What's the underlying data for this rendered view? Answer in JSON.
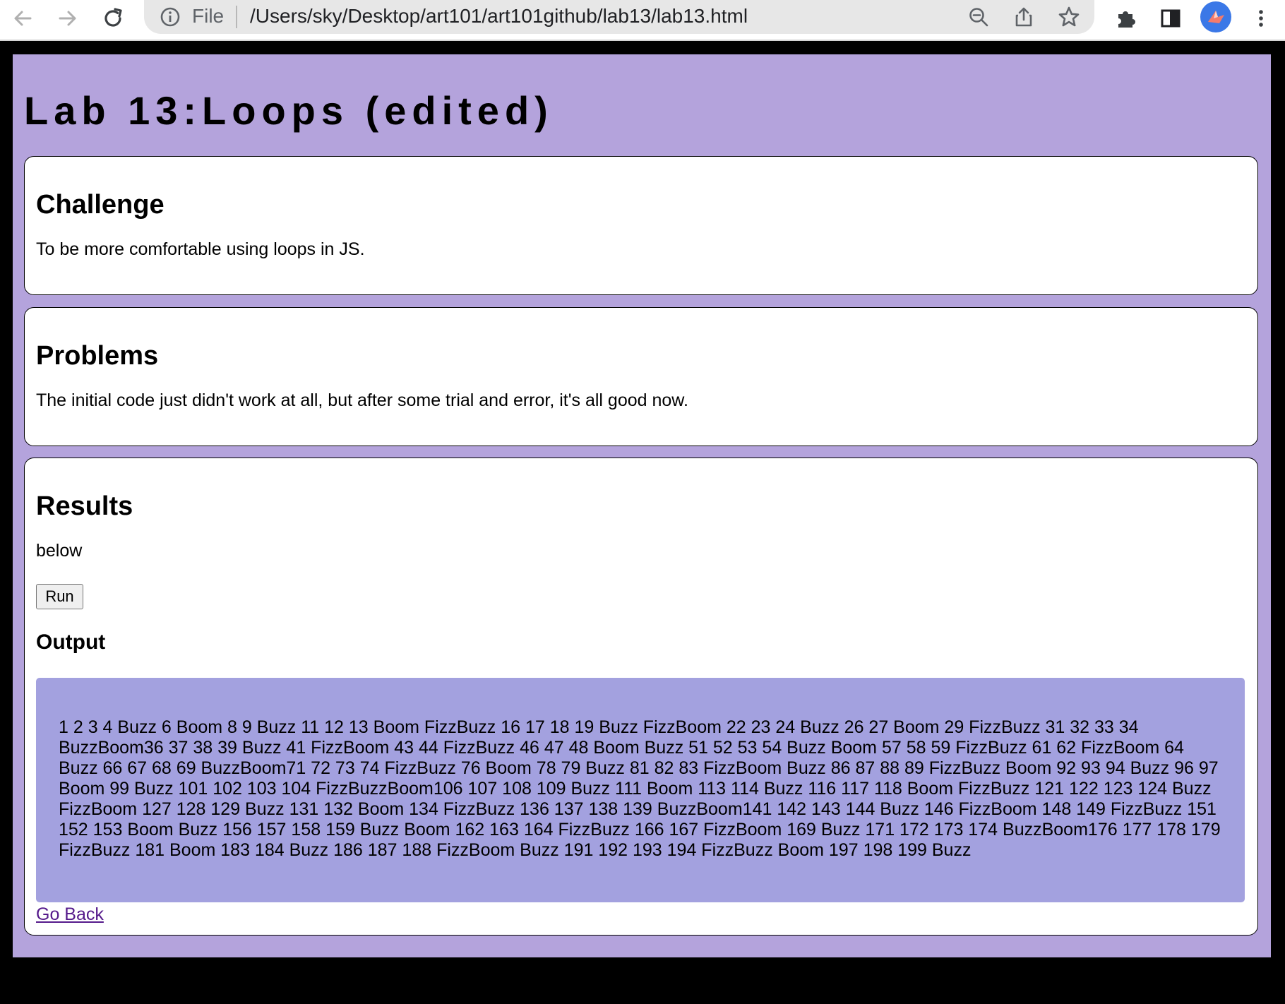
{
  "browser": {
    "file_label": "File",
    "url": "/Users/sky/Desktop/art101/art101github/lab13/lab13.html"
  },
  "page": {
    "title": "Lab 13:Loops (edited)",
    "background": "#b4a3dc"
  },
  "challenge": {
    "heading": "Challenge",
    "text": "To be more comfortable using loops in JS."
  },
  "problems": {
    "heading": "Problems",
    "text": "The initial code just didn't work at all, but after some trial and error, it's all good now."
  },
  "results": {
    "heading": "Results",
    "text": "below",
    "run_label": "Run",
    "output_heading": "Output",
    "output_text": "1 2 3 4 Buzz 6 Boom 8 9 Buzz 11 12 13 Boom FizzBuzz 16 17 18 19 Buzz FizzBoom 22 23 24 Buzz 26 27 Boom 29 FizzBuzz 31 32 33 34 BuzzBoom36 37 38 39 Buzz 41 FizzBoom 43 44 FizzBuzz 46 47 48 Boom Buzz 51 52 53 54 Buzz Boom 57 58 59 FizzBuzz 61 62 FizzBoom 64 Buzz 66 67 68 69 BuzzBoom71 72 73 74 FizzBuzz 76 Boom 78 79 Buzz 81 82 83 FizzBoom Buzz 86 87 88 89 FizzBuzz Boom 92 93 94 Buzz 96 97 Boom 99 Buzz 101 102 103 104 FizzBuzzBoom106 107 108 109 Buzz 111 Boom 113 114 Buzz 116 117 118 Boom FizzBuzz 121 122 123 124 Buzz FizzBoom 127 128 129 Buzz 131 132 Boom 134 FizzBuzz 136 137 138 139 BuzzBoom141 142 143 144 Buzz 146 FizzBoom 148 149 FizzBuzz 151 152 153 Boom Buzz 156 157 158 159 Buzz Boom 162 163 164 FizzBuzz 166 167 FizzBoom 169 Buzz 171 172 173 174 BuzzBoom176 177 178 179 FizzBuzz 181 Boom 183 184 Buzz 186 187 188 FizzBoom Buzz 191 192 193 194 FizzBuzz Boom 197 198 199 Buzz",
    "output_background": "#a3a1df"
  },
  "go_back_label": "Go Back"
}
